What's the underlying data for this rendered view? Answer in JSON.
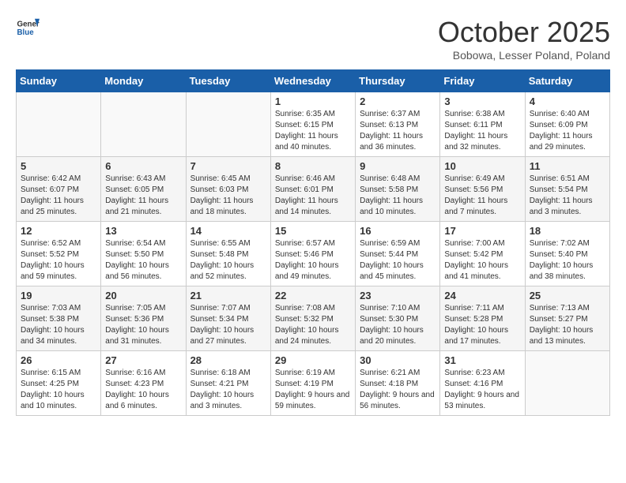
{
  "header": {
    "logo_general": "General",
    "logo_blue": "Blue",
    "month_title": "October 2025",
    "location": "Bobowa, Lesser Poland, Poland"
  },
  "days_of_week": [
    "Sunday",
    "Monday",
    "Tuesday",
    "Wednesday",
    "Thursday",
    "Friday",
    "Saturday"
  ],
  "weeks": [
    [
      {
        "day": "",
        "info": ""
      },
      {
        "day": "",
        "info": ""
      },
      {
        "day": "",
        "info": ""
      },
      {
        "day": "1",
        "info": "Sunrise: 6:35 AM\nSunset: 6:15 PM\nDaylight: 11 hours\nand 40 minutes."
      },
      {
        "day": "2",
        "info": "Sunrise: 6:37 AM\nSunset: 6:13 PM\nDaylight: 11 hours\nand 36 minutes."
      },
      {
        "day": "3",
        "info": "Sunrise: 6:38 AM\nSunset: 6:11 PM\nDaylight: 11 hours\nand 32 minutes."
      },
      {
        "day": "4",
        "info": "Sunrise: 6:40 AM\nSunset: 6:09 PM\nDaylight: 11 hours\nand 29 minutes."
      }
    ],
    [
      {
        "day": "5",
        "info": "Sunrise: 6:42 AM\nSunset: 6:07 PM\nDaylight: 11 hours\nand 25 minutes."
      },
      {
        "day": "6",
        "info": "Sunrise: 6:43 AM\nSunset: 6:05 PM\nDaylight: 11 hours\nand 21 minutes."
      },
      {
        "day": "7",
        "info": "Sunrise: 6:45 AM\nSunset: 6:03 PM\nDaylight: 11 hours\nand 18 minutes."
      },
      {
        "day": "8",
        "info": "Sunrise: 6:46 AM\nSunset: 6:01 PM\nDaylight: 11 hours\nand 14 minutes."
      },
      {
        "day": "9",
        "info": "Sunrise: 6:48 AM\nSunset: 5:58 PM\nDaylight: 11 hours\nand 10 minutes."
      },
      {
        "day": "10",
        "info": "Sunrise: 6:49 AM\nSunset: 5:56 PM\nDaylight: 11 hours\nand 7 minutes."
      },
      {
        "day": "11",
        "info": "Sunrise: 6:51 AM\nSunset: 5:54 PM\nDaylight: 11 hours\nand 3 minutes."
      }
    ],
    [
      {
        "day": "12",
        "info": "Sunrise: 6:52 AM\nSunset: 5:52 PM\nDaylight: 10 hours\nand 59 minutes."
      },
      {
        "day": "13",
        "info": "Sunrise: 6:54 AM\nSunset: 5:50 PM\nDaylight: 10 hours\nand 56 minutes."
      },
      {
        "day": "14",
        "info": "Sunrise: 6:55 AM\nSunset: 5:48 PM\nDaylight: 10 hours\nand 52 minutes."
      },
      {
        "day": "15",
        "info": "Sunrise: 6:57 AM\nSunset: 5:46 PM\nDaylight: 10 hours\nand 49 minutes."
      },
      {
        "day": "16",
        "info": "Sunrise: 6:59 AM\nSunset: 5:44 PM\nDaylight: 10 hours\nand 45 minutes."
      },
      {
        "day": "17",
        "info": "Sunrise: 7:00 AM\nSunset: 5:42 PM\nDaylight: 10 hours\nand 41 minutes."
      },
      {
        "day": "18",
        "info": "Sunrise: 7:02 AM\nSunset: 5:40 PM\nDaylight: 10 hours\nand 38 minutes."
      }
    ],
    [
      {
        "day": "19",
        "info": "Sunrise: 7:03 AM\nSunset: 5:38 PM\nDaylight: 10 hours\nand 34 minutes."
      },
      {
        "day": "20",
        "info": "Sunrise: 7:05 AM\nSunset: 5:36 PM\nDaylight: 10 hours\nand 31 minutes."
      },
      {
        "day": "21",
        "info": "Sunrise: 7:07 AM\nSunset: 5:34 PM\nDaylight: 10 hours\nand 27 minutes."
      },
      {
        "day": "22",
        "info": "Sunrise: 7:08 AM\nSunset: 5:32 PM\nDaylight: 10 hours\nand 24 minutes."
      },
      {
        "day": "23",
        "info": "Sunrise: 7:10 AM\nSunset: 5:30 PM\nDaylight: 10 hours\nand 20 minutes."
      },
      {
        "day": "24",
        "info": "Sunrise: 7:11 AM\nSunset: 5:28 PM\nDaylight: 10 hours\nand 17 minutes."
      },
      {
        "day": "25",
        "info": "Sunrise: 7:13 AM\nSunset: 5:27 PM\nDaylight: 10 hours\nand 13 minutes."
      }
    ],
    [
      {
        "day": "26",
        "info": "Sunrise: 6:15 AM\nSunset: 4:25 PM\nDaylight: 10 hours\nand 10 minutes."
      },
      {
        "day": "27",
        "info": "Sunrise: 6:16 AM\nSunset: 4:23 PM\nDaylight: 10 hours\nand 6 minutes."
      },
      {
        "day": "28",
        "info": "Sunrise: 6:18 AM\nSunset: 4:21 PM\nDaylight: 10 hours\nand 3 minutes."
      },
      {
        "day": "29",
        "info": "Sunrise: 6:19 AM\nSunset: 4:19 PM\nDaylight: 9 hours\nand 59 minutes."
      },
      {
        "day": "30",
        "info": "Sunrise: 6:21 AM\nSunset: 4:18 PM\nDaylight: 9 hours\nand 56 minutes."
      },
      {
        "day": "31",
        "info": "Sunrise: 6:23 AM\nSunset: 4:16 PM\nDaylight: 9 hours\nand 53 minutes."
      },
      {
        "day": "",
        "info": ""
      }
    ]
  ]
}
